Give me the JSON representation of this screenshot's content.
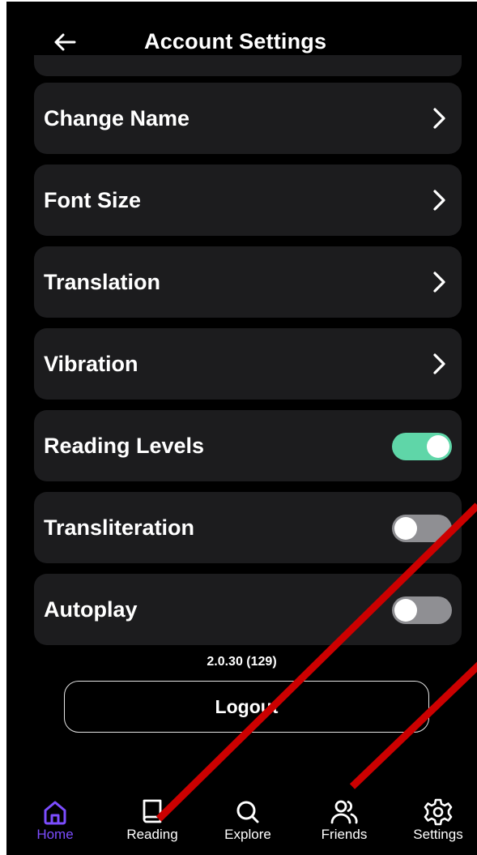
{
  "header": {
    "title": "Account Settings"
  },
  "settings": {
    "items": [
      {
        "label": "Change Name",
        "type": "link"
      },
      {
        "label": "Font Size",
        "type": "link"
      },
      {
        "label": "Translation",
        "type": "link"
      },
      {
        "label": "Vibration",
        "type": "link"
      },
      {
        "label": "Reading Levels",
        "type": "toggle",
        "on": true
      },
      {
        "label": "Transliteration",
        "type": "toggle",
        "on": false
      },
      {
        "label": "Autoplay",
        "type": "toggle",
        "on": false
      }
    ]
  },
  "version": "2.0.30 (129)",
  "logout_label": "Logout",
  "nav": {
    "items": [
      {
        "label": "Home",
        "icon": "home-icon",
        "active": true
      },
      {
        "label": "Reading",
        "icon": "book-icon",
        "active": false
      },
      {
        "label": "Explore",
        "icon": "search-icon",
        "active": false
      },
      {
        "label": "Friends",
        "icon": "friends-icon",
        "active": false
      },
      {
        "label": "Settings",
        "icon": "gear-icon",
        "active": false
      }
    ]
  },
  "colors": {
    "background": "#000000",
    "card": "#1c1c1e",
    "toggle_on": "#5fd6a8",
    "toggle_off": "#8f8f93",
    "accent": "#7c4dff",
    "annotation": "#cc0000"
  }
}
